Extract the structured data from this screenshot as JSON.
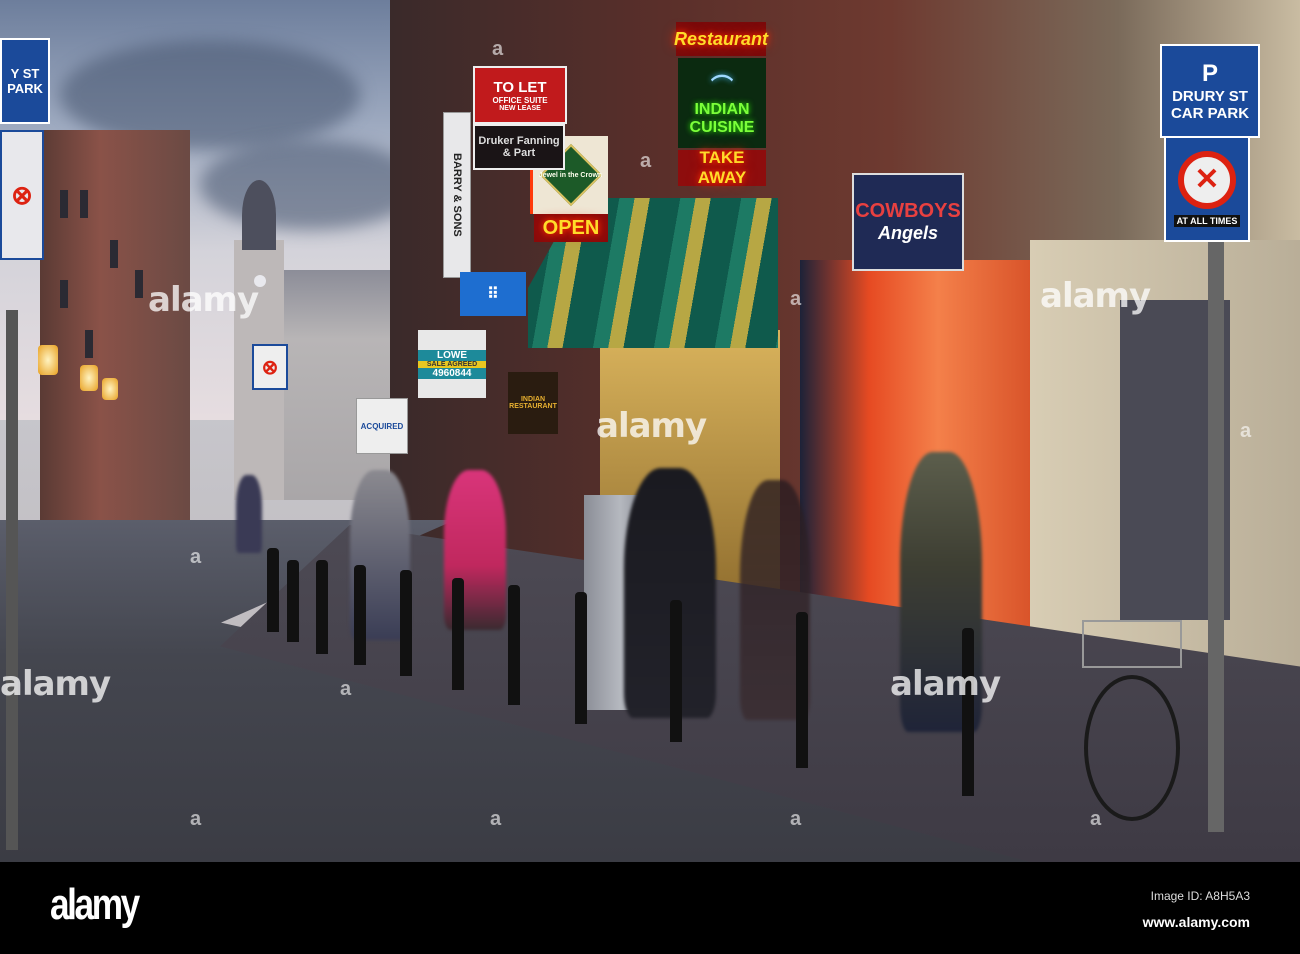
{
  "signs": {
    "car_park_left": "Y ST PARK",
    "car_park_right": {
      "p": "P",
      "line1": "DRURY ST",
      "line2": "CAR PARK"
    },
    "no_stopping_right": "AT ALL TIMES",
    "restaurant": "Restaurant",
    "indian_cuisine": {
      "line1": "INDIAN",
      "line2": "CUISINE"
    },
    "take_away": "TAKE AWAY",
    "jewel": "Jewel in the Crown",
    "open": "OPEN",
    "to_let": {
      "title": "TO LET",
      "sub": "OFFICE SUITE",
      "lease": "NEW LEASE",
      "agent": "Druker Fanning & Part"
    },
    "barry": "BARRY & SONS",
    "lowe": {
      "name": "LOWE",
      "status": "SALE AGREED",
      "phone": "4960844"
    },
    "cowboys": {
      "line1": "COWBOYS",
      "line2": "Angels"
    },
    "acquired": "ACQUIRED",
    "indian_restaurant": "INDIAN RESTAURANT"
  },
  "watermark": {
    "logo": "alamy",
    "image_id": "Image ID: A8H5A3",
    "url": "www.alamy.com",
    "tile": "a"
  }
}
